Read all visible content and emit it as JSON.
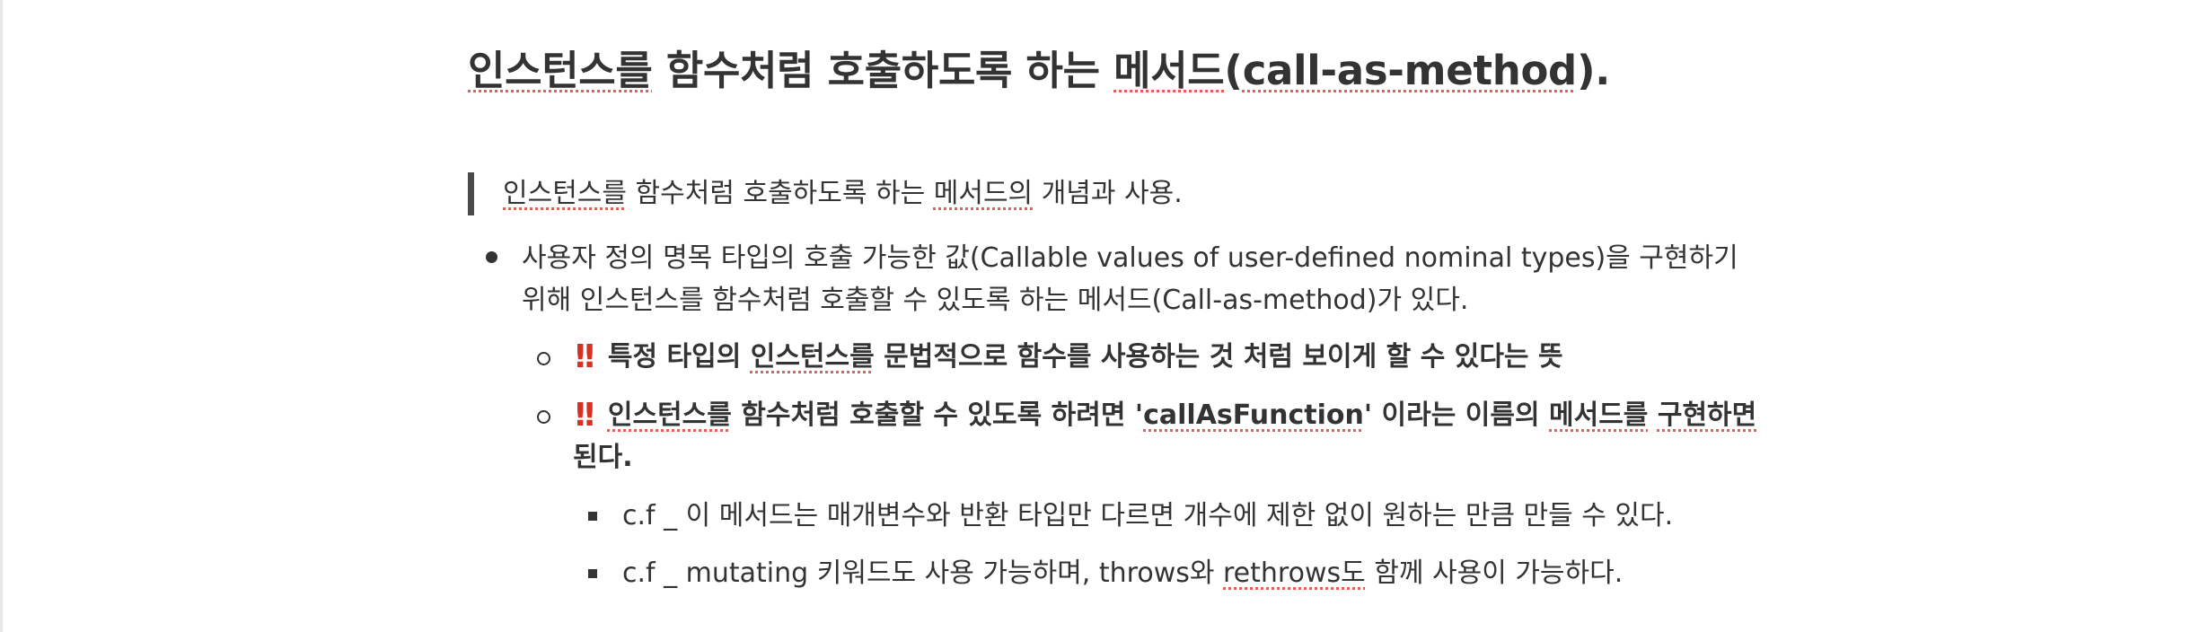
{
  "page": {
    "title_prefix": "인스턴스를",
    "title_middle": " 함수처럼 호출하도록 하는 ",
    "title_method": "메서드",
    "title_paren_open": "(",
    "title_call": "call-as-method",
    "title_suffix": ").",
    "quote": {
      "part1": "인스턴스를",
      "part2": " 함수처럼 호출하도록 하는 ",
      "part3": "메서드의",
      "part4": " 개념과 사용."
    },
    "bullet1": {
      "line1": "사용자 정의 명목 타입의 호출 가능한 값(Callable values of user-defined nominal types)을 구현하기",
      "line2": "위해 인스턴스를 함수처럼 호출할 수 있도록 하는 메서드(Call-as-method)가 있다."
    },
    "sub1": {
      "icon": "‼️",
      "part1": "특정 타입의 ",
      "part2": "인스턴스를",
      "part3": " 문법적으로 함수를 사용하는 것 처럼 보이게 할 수 있다는 뜻"
    },
    "sub2": {
      "icon": "‼️",
      "part1": "인스턴스를",
      "part2": " 함수처럼 호출할 수 있도록 하려면 '",
      "part3": "callAsFunction",
      "part4": "' 이라는 이름의 ",
      "part5": "메서드를",
      "part6": " ",
      "part7": "구현하면",
      "line2": "된다."
    },
    "subsub1": "c.f _ 이 메서드는 매개변수와 반환 타입만 다르면 개수에 제한 없이 원하는 만큼 만들 수 있다.",
    "subsub2": {
      "part1": "c.f _ mutating 키워드도 사용 가능하며, throws와 ",
      "part2": "rethrows도",
      "part3": " 함께 사용이 가능하다."
    }
  }
}
